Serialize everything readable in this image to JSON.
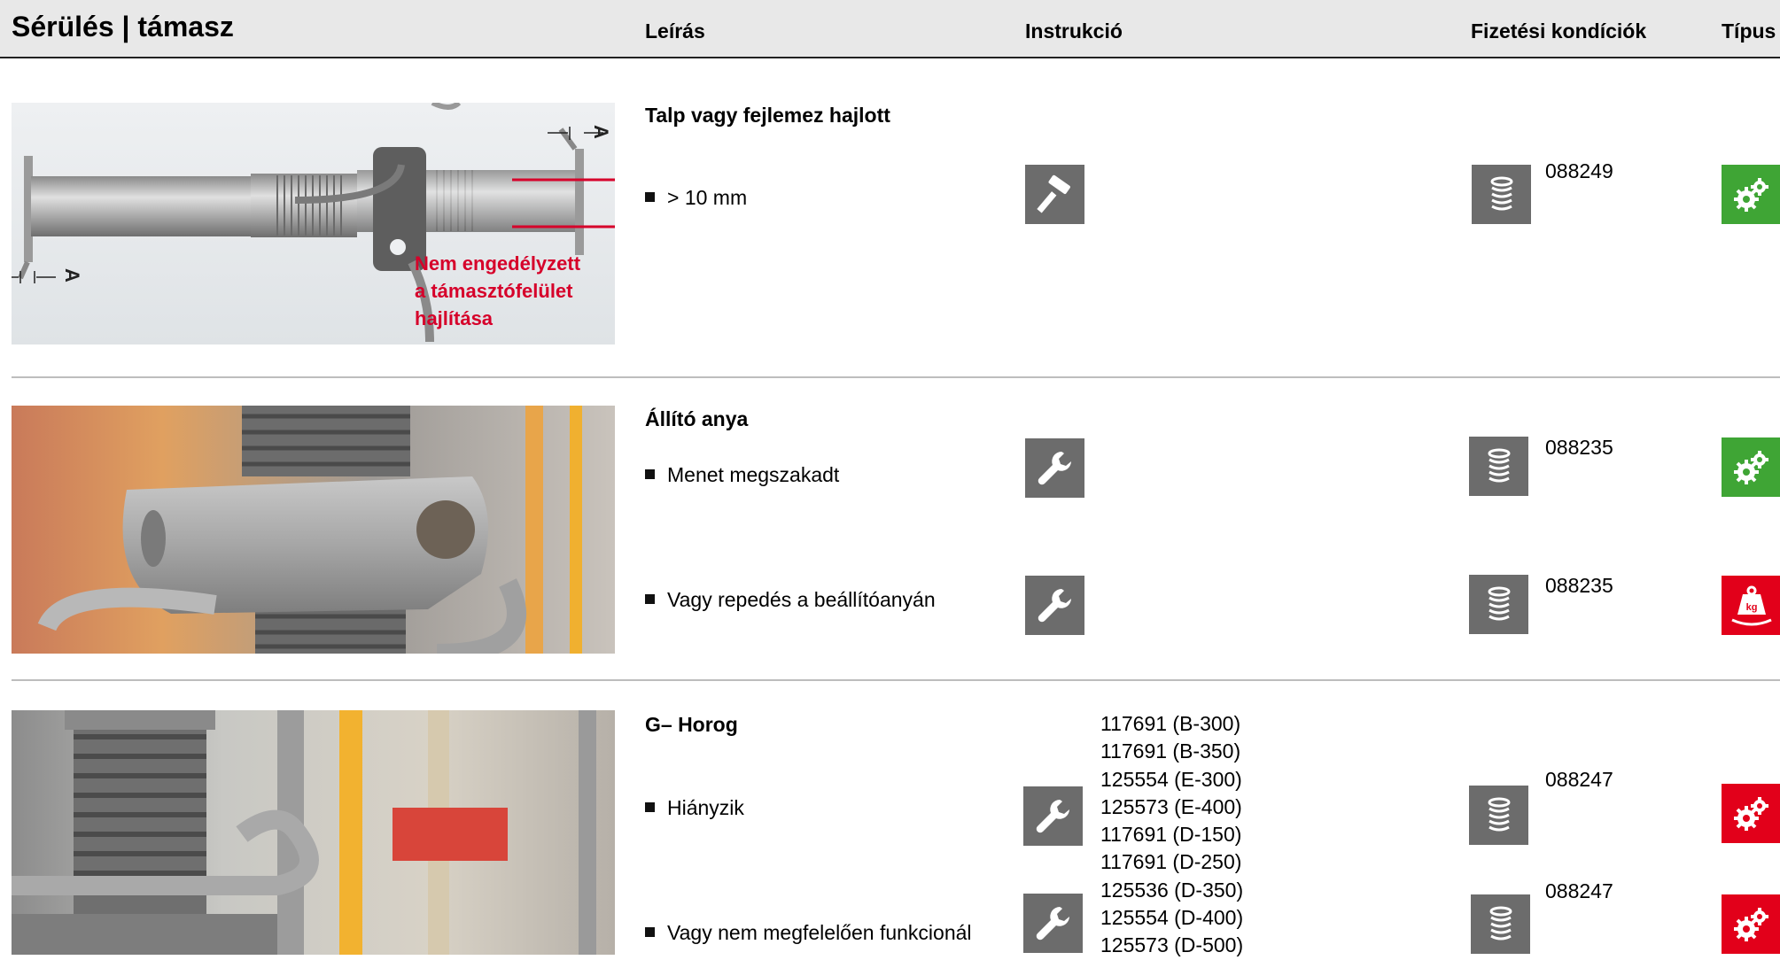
{
  "header": {
    "title": "Sérülés | támasz",
    "col_description": "Leírás",
    "col_instruction": "Instrukció",
    "col_payment": "Fizetési kondíciók",
    "col_type": "Típus"
  },
  "rows": [
    {
      "image_callout": [
        "Nem engedélyzett",
        "a támasztófelület",
        "hajlítása"
      ],
      "dimension_label": "A",
      "title": "Talp vagy fejlemez hajlott",
      "items": [
        {
          "text": "> 10 mm",
          "instruction_icon": "hammer-icon",
          "payment_icon": "coins-stack-icon",
          "code": "088249",
          "type_icon": "gears-icon",
          "type_color": "#3fa535"
        }
      ]
    },
    {
      "title": "Állító anya",
      "items": [
        {
          "text": "Menet megszakadt",
          "instruction_icon": "wrench-icon",
          "payment_icon": "coins-stack-icon",
          "code": "088235",
          "type_icon": "gears-icon",
          "type_color": "#3fa535"
        },
        {
          "text": "Vagy repedés a beállítóanyán",
          "instruction_icon": "wrench-icon",
          "payment_icon": "coins-stack-icon",
          "code": "088235",
          "type_icon": "weight-kg-icon",
          "type_color": "#e2001a",
          "type_label": "kg"
        }
      ]
    },
    {
      "title": "G– Horog",
      "parts": [
        "117691 (B-300)",
        "117691 (B-350)",
        "125554 (E-300)",
        "125573 (E-400)",
        "117691 (D-150)",
        "117691 (D-250)",
        "125536 (D-350)",
        "125554 (D-400)",
        "125573 (D-500)"
      ],
      "items": [
        {
          "text": "Hiányzik",
          "instruction_icon": "wrench-icon",
          "payment_icon": "coins-stack-icon",
          "code": "088247",
          "type_icon": "gears-icon",
          "type_color": "#e2001a"
        },
        {
          "text": "Vagy nem megfelelően funkcionál",
          "instruction_icon": "wrench-icon",
          "payment_icon": "coins-stack-icon",
          "code": "088247",
          "type_icon": "gears-icon",
          "type_color": "#e2001a"
        }
      ]
    }
  ]
}
